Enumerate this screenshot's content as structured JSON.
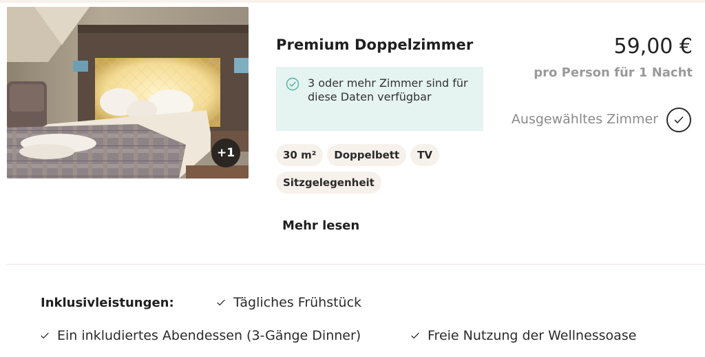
{
  "room": {
    "title": "Premium Doppelzimmer",
    "photo_more": "+1",
    "availability": "3 oder mehr Zimmer sind für diese Daten verfügbar",
    "tags": [
      "30 m²",
      "Doppelbett",
      "TV",
      "Sitzgelegenheit"
    ],
    "read_more": "Mehr lesen"
  },
  "pricing": {
    "price": "59,00 €",
    "per": "pro Person für 1 Nacht",
    "selected": "Ausgewähltes Zimmer"
  },
  "inclusions": {
    "label": "Inklusivleistungen:",
    "items": [
      "Tägliches Frühstück",
      "Ein inkludiertes Abendessen (3-Gänge Dinner)",
      "Freie Nutzung der Wellnessoase"
    ]
  },
  "colors": {
    "availability_bg": "#e5f3f1",
    "availability_icon": "#4bb3a0",
    "tag_bg": "#f6f1eb",
    "muted_text": "#9a9a9a"
  },
  "icons": {
    "availability": "check-circle-icon",
    "selected": "check-icon",
    "inclusion": "check-icon"
  }
}
